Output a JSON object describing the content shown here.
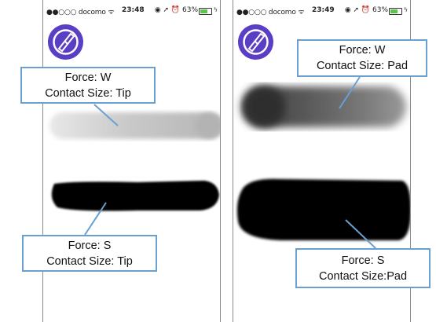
{
  "screens": [
    {
      "status": {
        "carrier": "●●○○○ docomo ᯤ",
        "time": "23:48",
        "icons": "◉ ➚ ⏰ 63%"
      },
      "callouts": [
        {
          "line1": "Force: W",
          "line2": "Contact Size: Tip"
        },
        {
          "line1": "Force: S",
          "line2": "Contact Size: Tip"
        }
      ]
    },
    {
      "status": {
        "carrier": "●●○○○ docomo ᯤ",
        "time": "23:49",
        "icons": "◉ ➚ ⏰ 63%"
      },
      "callouts": [
        {
          "line1": "Force: W",
          "line2": "Contact Size: Pad"
        },
        {
          "line1": "Force: S",
          "line2": "Contact Size:Pad"
        }
      ]
    }
  ],
  "icons": {
    "logo": "pen-nib-logo-icon",
    "battery": "battery-icon",
    "charging": "charging-bolt-icon"
  },
  "colors": {
    "logo_bg": "#5a3fc5",
    "callout_border": "#6a9fd1",
    "battery_fill": "#5dc24e",
    "ink": "#000000"
  }
}
